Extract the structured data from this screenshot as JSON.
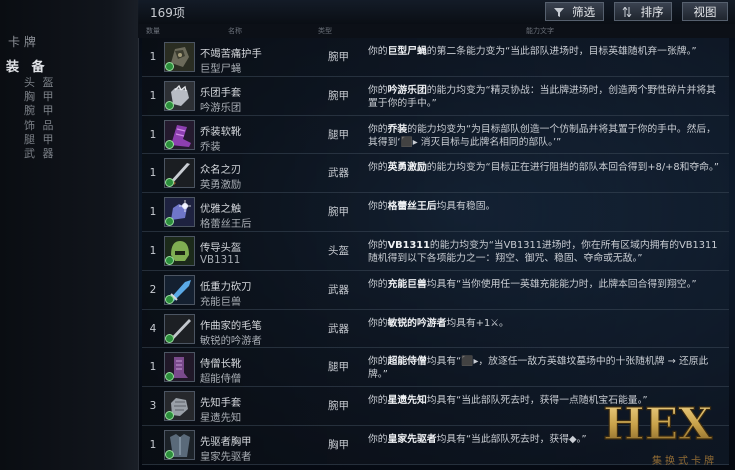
{
  "sidebar": {
    "title": "卡 牌",
    "section": "装 备",
    "items": [
      "头 盔",
      "胸 甲",
      "腕 甲",
      "饰 品",
      "腿 甲",
      "武 器"
    ]
  },
  "toolbar": {
    "count": "169项",
    "filter_label": "筛选",
    "sort_label": "排序",
    "view_label": "视图"
  },
  "columns": {
    "qty": "数量",
    "name": "名称",
    "slot": "类型",
    "desc": "能力文字"
  },
  "colors": {
    "accent": "#5a6676",
    "gem_green": "#2c8f3c",
    "logo_gold": "#c9a24a"
  },
  "rows": [
    {
      "qty": "1",
      "name": "不竭苦痛护手",
      "sub": "巨型尸蝇",
      "slot": "腕甲",
      "icon": "gauntlet-icon",
      "desc_a": "你的",
      "desc_b": "巨型尸蝇",
      "desc_c": "的第二条能力变为“当此部队进场时，目标英雄随机弃一张牌。”"
    },
    {
      "qty": "1",
      "name": "乐团手套",
      "sub": "吟游乐团",
      "slot": "腕甲",
      "icon": "glove-icon",
      "desc_a": "你的",
      "desc_b": "吟游乐团",
      "desc_c": "的能力均变为“精灵协战：当此牌进场时，创造两个野性碎片并将其置于你的手中。”"
    },
    {
      "qty": "1",
      "name": "乔装软靴",
      "sub": "乔装",
      "slot": "腿甲",
      "icon": "boots-icon",
      "desc_a": "你的",
      "desc_b": "乔装",
      "desc_c": "的能力均变为“为目标部队创造一个仿制品并将其置于你的手中。然后，其得到‘⬛▸ 消灭目标与此牌名相同的部队。’”"
    },
    {
      "qty": "1",
      "name": "众名之刃",
      "sub": "英勇激励",
      "slot": "武器",
      "icon": "sword-icon",
      "desc_a": "你的",
      "desc_b": "英勇激励",
      "desc_c": "的能力均变为“目标正在进行阻挡的部队本回合得到+8/+8和夺命。”"
    },
    {
      "qty": "1",
      "name": "优雅之触",
      "sub": "格蕾丝王后",
      "slot": "腕甲",
      "icon": "sparkle-glove-icon",
      "desc_a": "你的",
      "desc_b": "格蕾丝王后",
      "desc_c": "均具有稳固。"
    },
    {
      "qty": "1",
      "name": "传导头盔",
      "sub": "VB1311",
      "slot": "头盔",
      "icon": "helmet-icon",
      "desc_a": "你的",
      "desc_b": "VB1311",
      "desc_c": "的能力均变为“当VB1311进场时，你在所有区域内拥有的VB1311随机得到以下各项能力之一：翔空、御咒、稳固、夺命或无敌。”"
    },
    {
      "qty": "2",
      "name": "低重力砍刀",
      "sub": "充能巨兽",
      "slot": "武器",
      "icon": "blade-icon",
      "desc_a": "你的",
      "desc_b": "充能巨兽",
      "desc_c": "均具有“当你使用任一英雄充能能力时，此牌本回合得到翔空。”"
    },
    {
      "qty": "4",
      "name": "作曲家的毛笔",
      "sub": "敏锐的吟游者",
      "slot": "武器",
      "icon": "brush-icon",
      "desc_a": "你的",
      "desc_b": "敏锐的吟游者",
      "desc_c": "均具有+1⚔。"
    },
    {
      "qty": "1",
      "name": "侍僧长靴",
      "sub": "超能侍僧",
      "slot": "腿甲",
      "icon": "greaves-icon",
      "desc_a": "你的",
      "desc_b": "超能侍僧",
      "desc_c": "均具有“⬛▸，放逐任一敌方英雄坟墓场中的十张随机牌 → 还原此牌。”"
    },
    {
      "qty": "3",
      "name": "先知手套",
      "sub": "星遗先知",
      "slot": "腕甲",
      "icon": "armored-glove-icon",
      "desc_a": "你的",
      "desc_b": "星遗先知",
      "desc_c": "均具有“当此部队死去时，获得一点随机宝石能量。”"
    },
    {
      "qty": "1",
      "name": "先驱者胸甲",
      "sub": "皇家先驱者",
      "slot": "胸甲",
      "icon": "chestplate-icon",
      "desc_a": "你的",
      "desc_b": "皇家先驱者",
      "desc_c": "均具有“当此部队死去时，获得◆。”"
    }
  ],
  "logo": {
    "text": "HEX",
    "sub": "集换式卡牌"
  }
}
